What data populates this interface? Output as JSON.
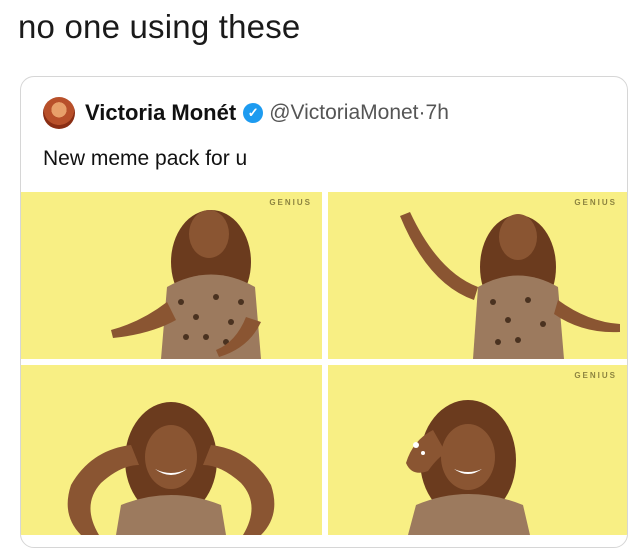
{
  "post": {
    "caption": "no one using these"
  },
  "tweet": {
    "author_name": "Victoria Monét",
    "verified_icon": "check-badge-icon",
    "handle": "@VictoriaMonet",
    "separator": " · ",
    "time": "7h",
    "text": "New meme pack for u"
  },
  "media": {
    "watermark": "GENIUS",
    "background_color": "#f8ef84"
  }
}
